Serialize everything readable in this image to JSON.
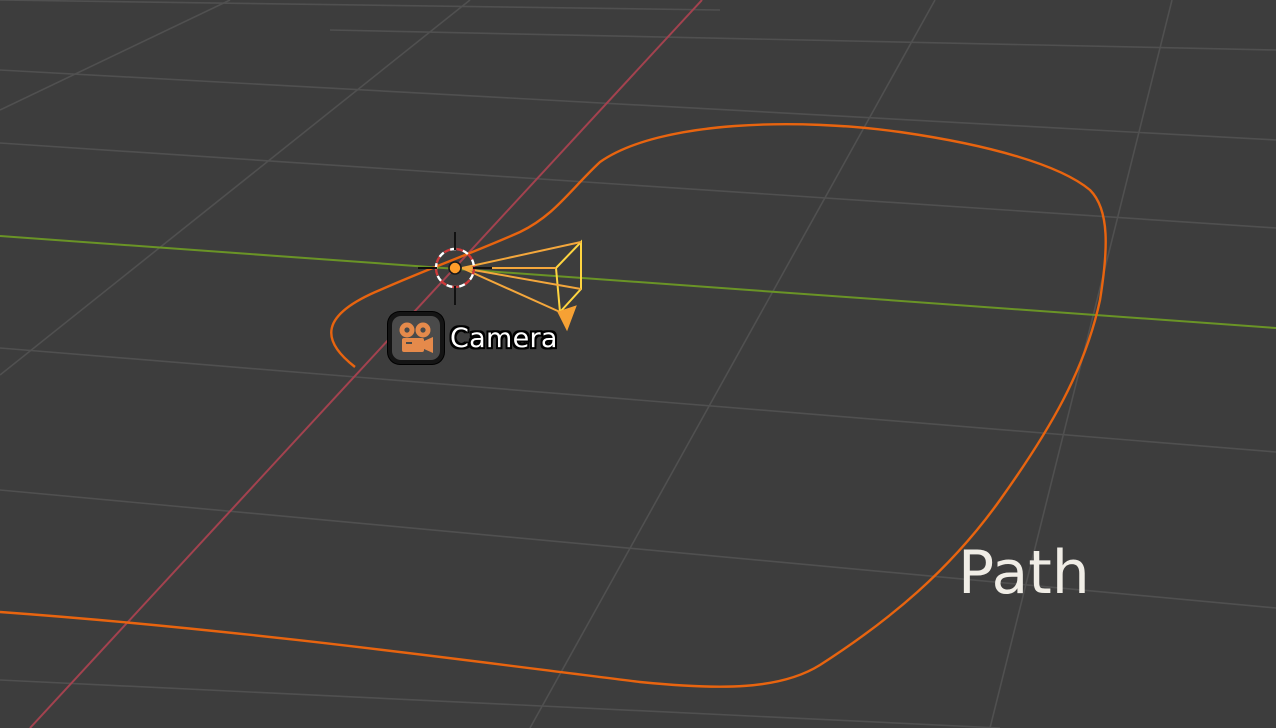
{
  "viewport": {
    "background": "#3d3d3d",
    "grid_color": "#4f4f4f",
    "x_axis_color": "#b0414e",
    "y_axis_color": "#6a9426"
  },
  "objects": {
    "camera": {
      "label": "Camera",
      "icon": "movie-camera-icon",
      "color": "#f4a73c",
      "selected_color": "#ffb83a"
    },
    "path": {
      "label": "Path",
      "color": "#e8640f"
    }
  },
  "origin": {
    "icon": "3d-cursor-icon",
    "origin_color": "#ff9d2a"
  }
}
